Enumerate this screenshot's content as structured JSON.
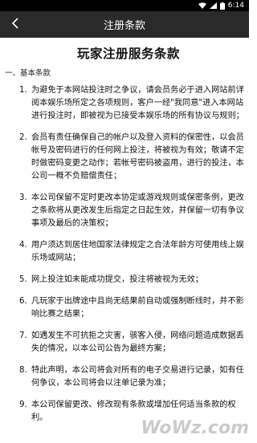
{
  "status_bar": {
    "time": "6:14"
  },
  "app_bar": {
    "title": "注册条款"
  },
  "document": {
    "title": "玩家注册服务条款",
    "section": "一、基本条款",
    "items": [
      {
        "num": "1.",
        "text": "为避免于本网站投注时之争议，请会员务必于进入网站前详阅本娱乐场所定之各项规则，客户一经\"我同意\"进入本网站进行投注时，即被视为已接受本娱乐场的所有协议与规则；"
      },
      {
        "num": "2.",
        "text": "会员有责任确保自己的帐户以及登入资料的保密性，以会员帐号及密码进行的任何网上投注，将被视为有效；敬请不定时做密码变更之动作；若帐号密码被盗用，进行的投注，本公司一概不负赔偿责任；"
      },
      {
        "num": "3.",
        "text": "本公司保留不定时更改本协定或游戏规则或保密条例，更改之条款将从更改发生后指定之日起生效，并保留一切有争议事项及最后的决策权；"
      },
      {
        "num": "4.",
        "text": "用户须达到居住地国家法律规定之合法年龄方可使用线上娱乐场或网站；"
      },
      {
        "num": "5.",
        "text": "网上投注如未能成功提交，投注将被视为无效；"
      },
      {
        "num": "6.",
        "text": "凡玩家于出牌途中且尚无结果前自动或强制断线时，并不影响比赛之结果；"
      },
      {
        "num": "7.",
        "text": "如遇发生不可抗拒之灾害，骇客入侵，网络问题造成数据丢失的情况，以本公司公告为最终方案；"
      },
      {
        "num": "8.",
        "text": "特此声明，本公司将会对所有的电子交易进行记录，如有任何争议，本公司将会以注单记录为准；"
      },
      {
        "num": "9.",
        "text": "本公司保留更改、修改现有条款或增加任何适当条款的权利。"
      }
    ]
  },
  "watermark": "WoWz.com"
}
